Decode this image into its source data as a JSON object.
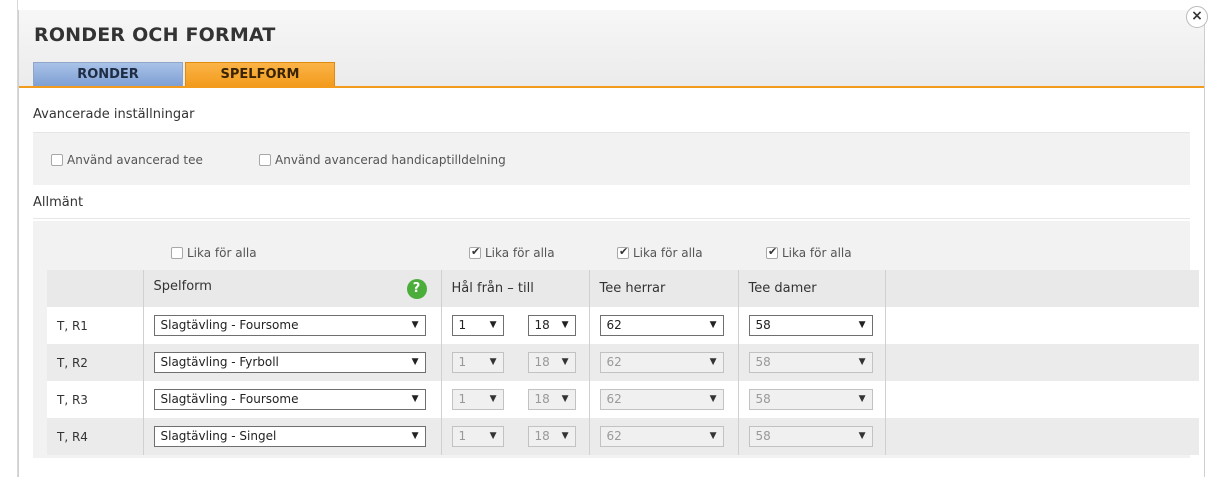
{
  "dialog": {
    "title": "RONDER OCH FORMAT",
    "close": "×",
    "tabs": [
      {
        "label": "RONDER",
        "active": false
      },
      {
        "label": "SPELFORM",
        "active": true
      }
    ]
  },
  "advanced": {
    "title": "Avancerade inställningar",
    "options": [
      {
        "label": "Använd avancerad tee",
        "checked": false
      },
      {
        "label": "Använd avancerad handicaptilldelning",
        "checked": false
      }
    ]
  },
  "general": {
    "title": "Allmänt",
    "same_for_all": [
      {
        "label": "Lika för alla",
        "checked": false
      },
      {
        "label": "Lika för alla",
        "checked": true
      },
      {
        "label": "Lika för alla",
        "checked": true
      },
      {
        "label": "Lika för alla",
        "checked": true
      }
    ],
    "columns": [
      "",
      "Spelform",
      "Hål från – till",
      "Tee herrar",
      "Tee damer",
      ""
    ],
    "help_icon": "?",
    "rows": [
      {
        "round": "T, R1",
        "spelform": "Slagtävling - Foursome",
        "hole_from": "1",
        "hole_to": "18",
        "tee_men": "62",
        "tee_women": "58",
        "editable": true
      },
      {
        "round": "T, R2",
        "spelform": "Slagtävling - Fyrboll",
        "hole_from": "1",
        "hole_to": "18",
        "tee_men": "62",
        "tee_women": "58",
        "editable": false
      },
      {
        "round": "T, R3",
        "spelform": "Slagtävling - Foursome",
        "hole_from": "1",
        "hole_to": "18",
        "tee_men": "62",
        "tee_women": "58",
        "editable": false
      },
      {
        "round": "T, R4",
        "spelform": "Slagtävling - Singel",
        "hole_from": "1",
        "hole_to": "18",
        "tee_men": "62",
        "tee_women": "58",
        "editable": false
      }
    ],
    "dropdown_arrow": "▼"
  },
  "colors": {
    "accent_orange": "#f29b1d",
    "tab_blue": "#7e9fd3",
    "help_green": "#4cae3a"
  }
}
